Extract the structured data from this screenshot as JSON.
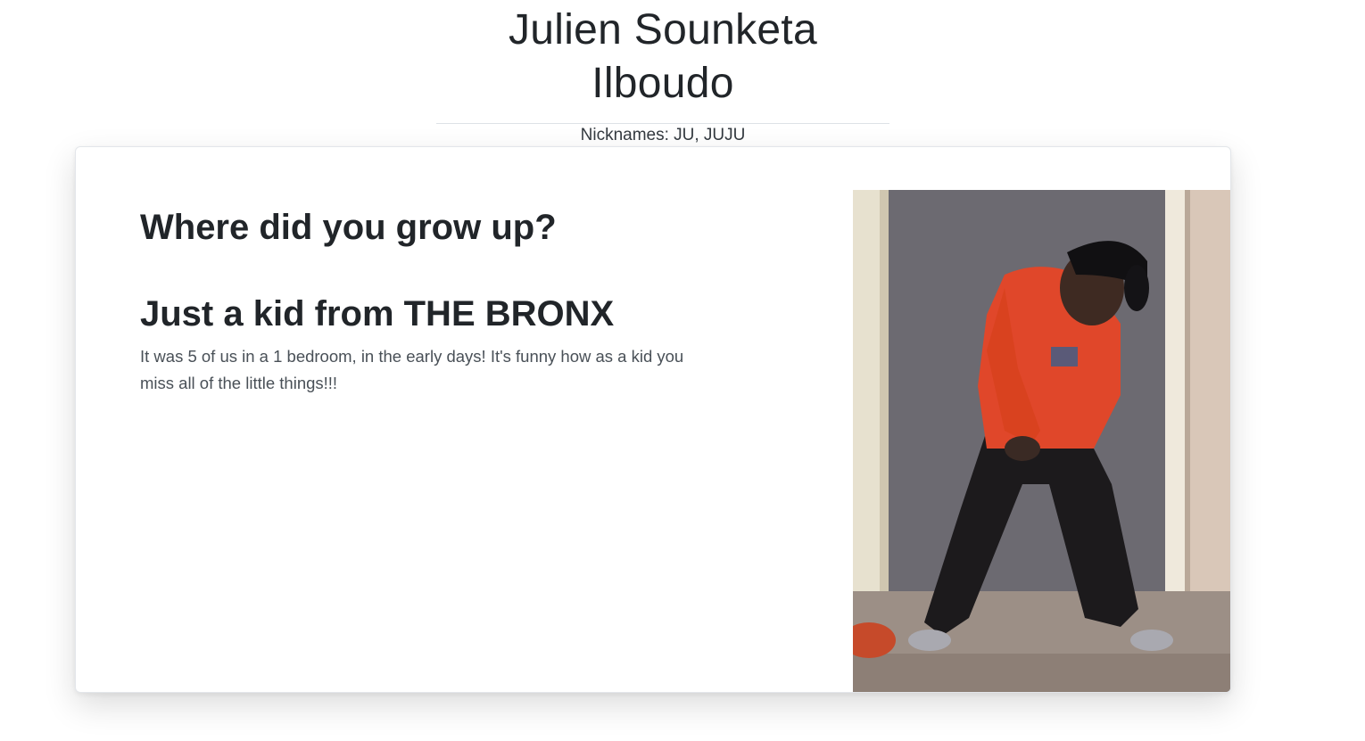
{
  "header": {
    "title": "Julien Sounketa Ilboudo",
    "nicknames": "Nicknames: JU, JUJU"
  },
  "card": {
    "question": "Where did you grow up?",
    "answer_title": "Just a kid from THE BRONX",
    "answer_body": "It was 5 of us in a 1 bedroom, in the early days! It's funny how as a kid you miss all of the little things!!!"
  },
  "photo": {
    "subject": "childhood-photo"
  },
  "colors": {
    "text": "#212529",
    "muted": "#495057",
    "divider": "#dee2e6",
    "shirt": "#e0472a"
  }
}
